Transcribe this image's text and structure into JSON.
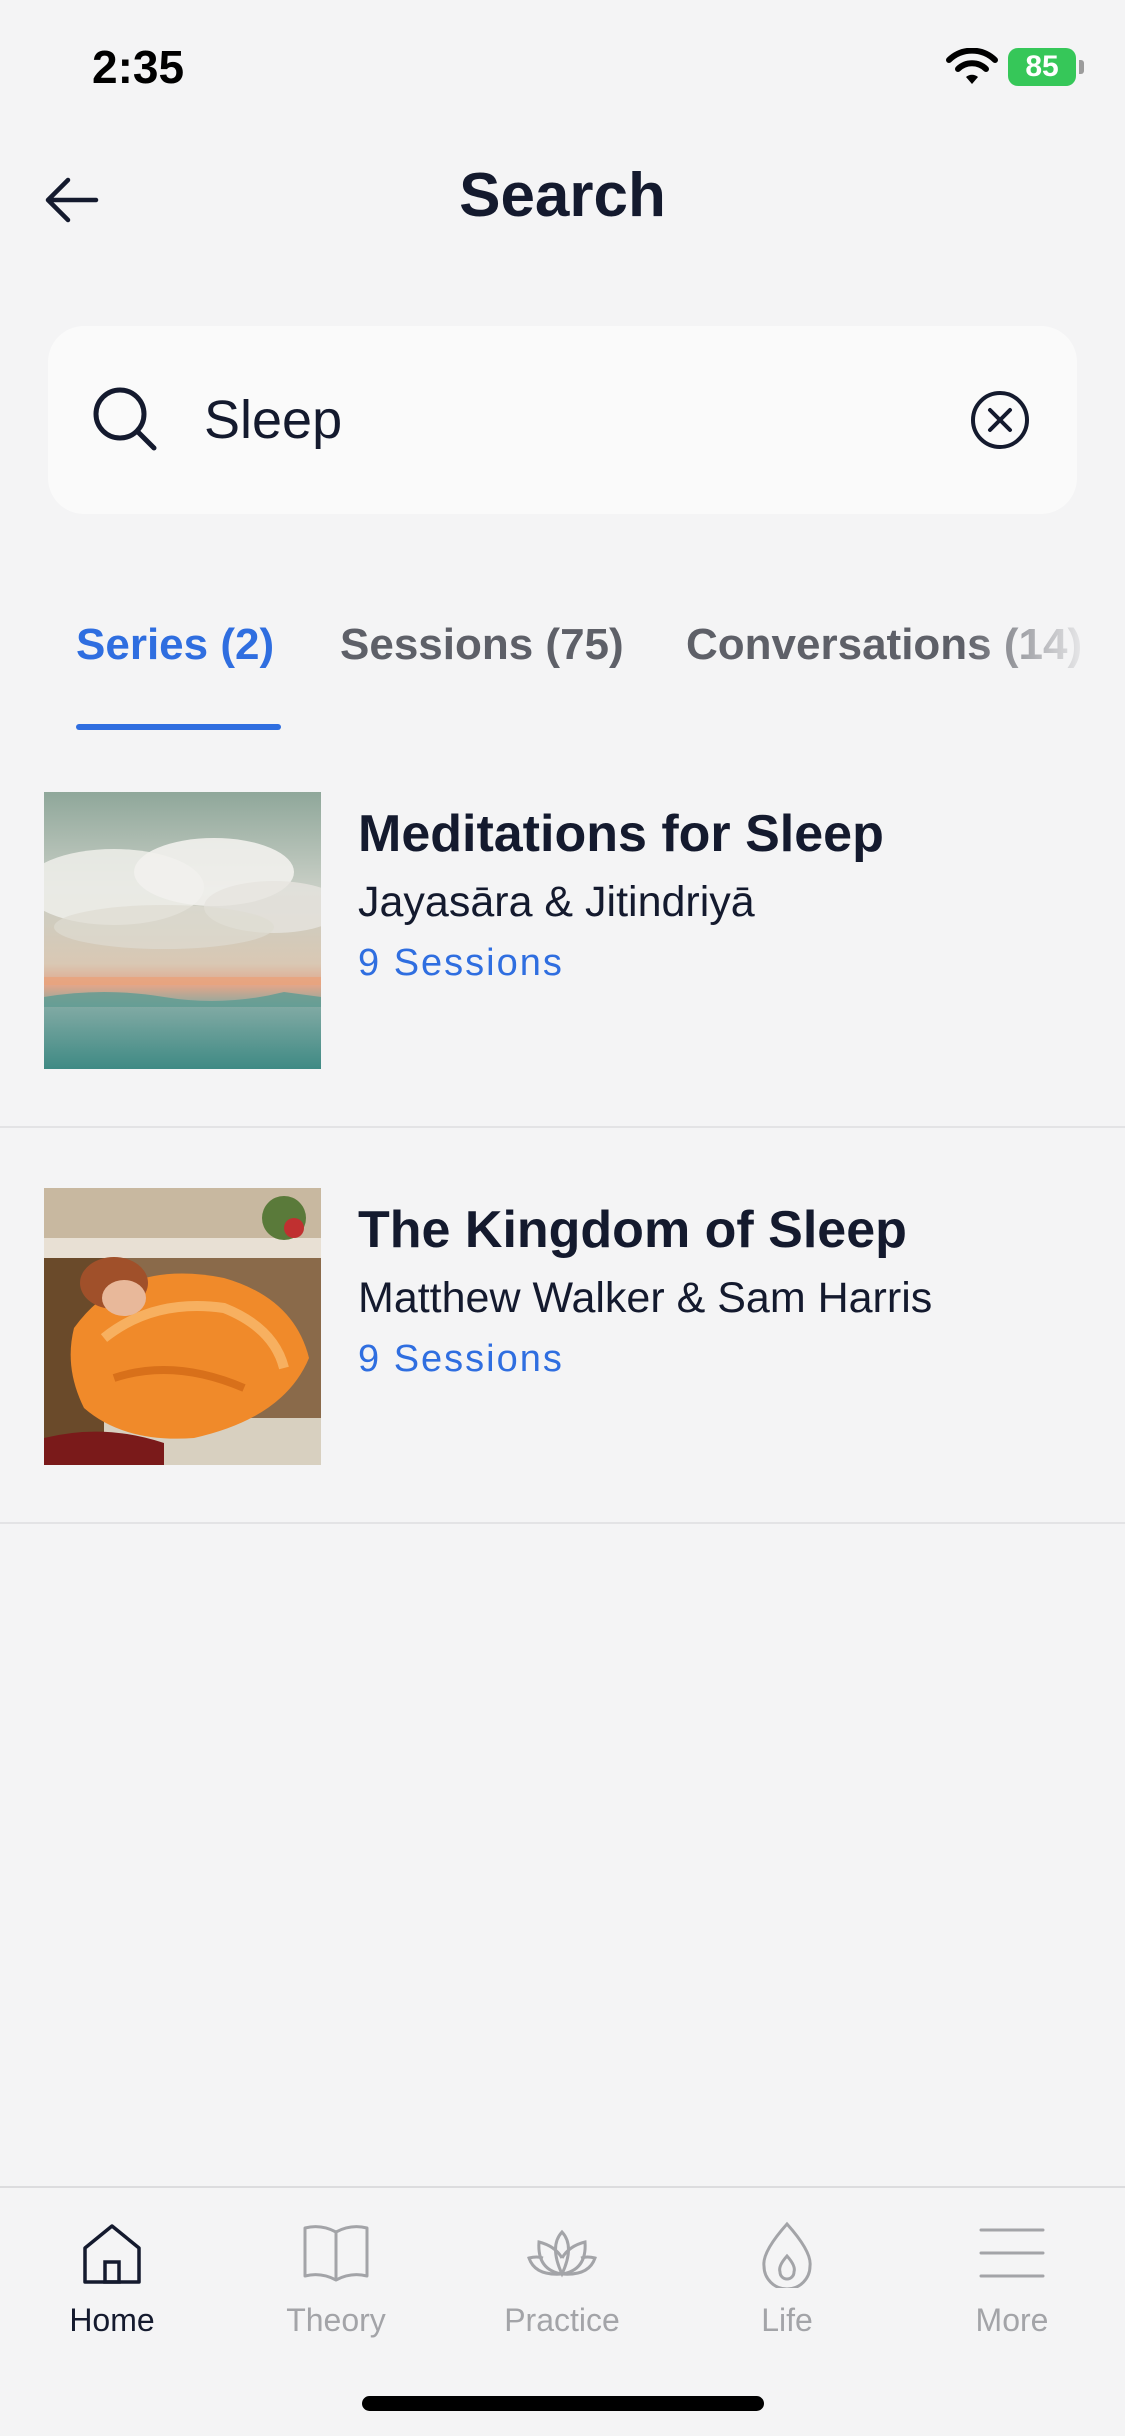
{
  "status_bar": {
    "time": "2:35",
    "battery": "85"
  },
  "header": {
    "title": "Search",
    "back_icon": "arrow-left-icon"
  },
  "search": {
    "value": "Sleep",
    "placeholder": "",
    "search_icon": "search-icon",
    "clear_icon": "clear-circle-icon"
  },
  "tabs": [
    {
      "label": "Series (2)",
      "active": true
    },
    {
      "label": "Sessions (75)",
      "active": false
    },
    {
      "label": "Conversations (14)",
      "active": false
    }
  ],
  "results": [
    {
      "title": "Meditations for Sleep",
      "author": "Jayasāra & Jitindriyā",
      "sessions": "9 Sessions",
      "image": "clouds-painting"
    },
    {
      "title": "The Kingdom of Sleep",
      "author": "Matthew Walker & Sam Harris",
      "sessions": "9 Sessions",
      "image": "sleeping-woman-painting"
    }
  ],
  "nav": [
    {
      "label": "Home",
      "icon": "home-icon",
      "active": true
    },
    {
      "label": "Theory",
      "icon": "book-icon",
      "active": false
    },
    {
      "label": "Practice",
      "icon": "lotus-icon",
      "active": false
    },
    {
      "label": "Life",
      "icon": "flame-icon",
      "active": false
    },
    {
      "label": "More",
      "icon": "menu-icon",
      "active": false
    }
  ],
  "colors": {
    "accent": "#2f6ee0",
    "text": "#141a2e",
    "background": "#f4f4f5",
    "battery": "#36c759"
  }
}
